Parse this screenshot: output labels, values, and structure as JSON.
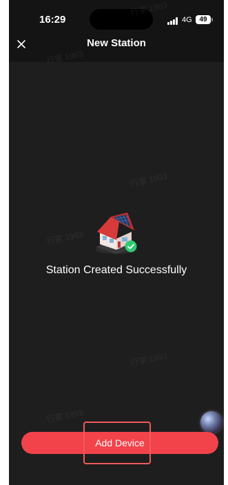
{
  "status_bar": {
    "time": "16:29",
    "network": "4G",
    "battery": "49"
  },
  "nav": {
    "title": "New Station"
  },
  "main": {
    "message": "Station Created Successfully"
  },
  "actions": {
    "add_device_label": "Add Device"
  },
  "watermark": {
    "text": "行家 1993"
  },
  "icons": {
    "close": "close-icon",
    "illustration": "house-solar-illustration",
    "check": "check-icon",
    "assistant": "assistant-bubble-icon"
  },
  "colors": {
    "background": "#1e1e1e",
    "accent": "#f2434a",
    "success": "#2ecc71",
    "text": "#ffffff"
  }
}
